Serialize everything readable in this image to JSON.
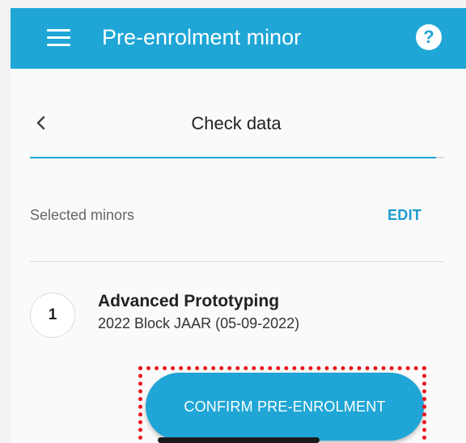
{
  "app_bar": {
    "title": "Pre-enrolment minor",
    "menu_icon": "menu-icon",
    "help_icon": "help-icon",
    "help_glyph": "?",
    "background_color": "#1fa6d6"
  },
  "step": {
    "back_icon": "chevron-left-icon",
    "title": "Check data",
    "progress_fraction": 0.98
  },
  "selected_minors": {
    "label": "Selected minors",
    "edit_label": "EDIT",
    "items": [
      {
        "number": "1",
        "name": "Advanced Prototyping",
        "block": "2022 Block JAAR (05-09-2022)"
      }
    ]
  },
  "actions": {
    "confirm_label": "CONFIRM PRE-ENROLMENT",
    "highlight_color": "#e8141a"
  }
}
